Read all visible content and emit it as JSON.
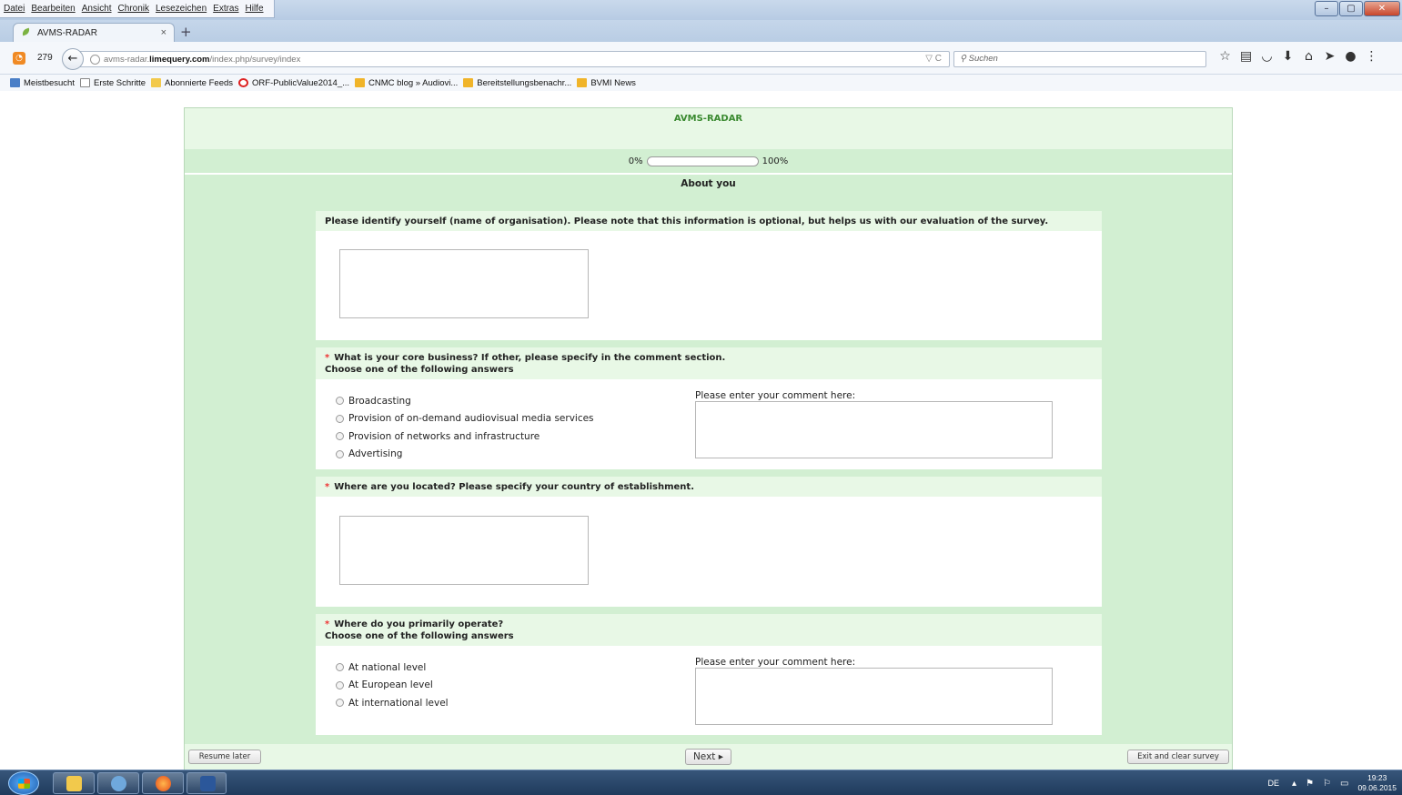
{
  "browser": {
    "menu": [
      "Datei",
      "Bearbeiten",
      "Ansicht",
      "Chronik",
      "Lesezeichen",
      "Extras",
      "Hilfe"
    ],
    "tab": {
      "title": "AVMS-RADAR",
      "close": "×"
    },
    "new_tab": "+",
    "rss_count": "279",
    "url_prefix": "avms-radar.",
    "url_domain": "limequery.com",
    "url_path": "/index.php/survey/index",
    "url_icons": "▽ C",
    "search_placeholder": "Suchen",
    "bookmarks": [
      {
        "label": "Meistbesucht",
        "icon": "blue"
      },
      {
        "label": "Erste Schritte",
        "icon": "page"
      },
      {
        "label": "Abonnierte Feeds",
        "icon": "folder"
      },
      {
        "label": "ORF-PublicValue2014_...",
        "icon": "orf"
      },
      {
        "label": "CNMC blog » Audiovi...",
        "icon": "rss"
      },
      {
        "label": "Bereitstellungsbenachr...",
        "icon": "rss"
      },
      {
        "label": "BVMI News",
        "icon": "rss"
      }
    ]
  },
  "survey": {
    "site_title": "AVMS-RADAR",
    "progress": {
      "min_label": "0%",
      "max_label": "100%",
      "value_percent": 0
    },
    "group_title": "About you",
    "questions": [
      {
        "text": "Please identify yourself (name of organisation). Please note that this information is optional, but helps us with our evaluation of the survey.",
        "required": false
      },
      {
        "text": "What is your core business? If other, please specify in the comment section.",
        "required": true,
        "help": "Choose one of the following answers",
        "options": [
          "Broadcasting",
          "Provision of on-demand audiovisual media services",
          "Provision of networks and infrastructure",
          "Advertising"
        ],
        "comment_label": "Please enter your comment here:"
      },
      {
        "text": "Where are you located? Please specify your country of establishment.",
        "required": true
      },
      {
        "text": "Where do you primarily operate?",
        "required": true,
        "help": "Choose one of the following answers",
        "options": [
          "At national level",
          "At European level",
          "At international level"
        ],
        "comment_label": "Please enter your comment here:"
      }
    ],
    "required_marker": "*",
    "buttons": {
      "resume": "Resume later",
      "next": "Next ▸",
      "exit": "Exit and clear survey"
    }
  },
  "taskbar": {
    "lang": "DE",
    "time": "19:23",
    "date": "09.06.2015"
  },
  "colors": {
    "accent_green": "#3a8a30",
    "page_bg": "#d2efd2",
    "required": "#e33"
  }
}
